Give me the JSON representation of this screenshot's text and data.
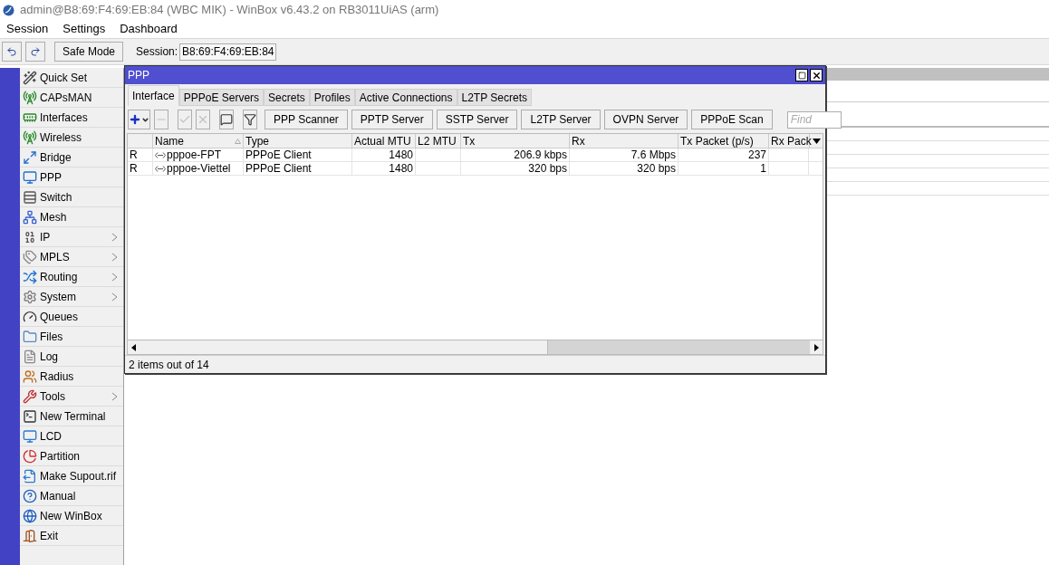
{
  "window": {
    "title": "admin@B8:69:F4:69:EB:84 (WBC MIK) - WinBox v6.43.2 on RB3011UiAS (arm)"
  },
  "menu": [
    "Session",
    "Settings",
    "Dashboard"
  ],
  "toolbar": {
    "safe_mode": {
      "label": "Safe Mode",
      "on": false
    },
    "session_label": "Session:",
    "session_value": "B8:69:F4:69:EB:84"
  },
  "sidebar": {
    "items": [
      {
        "label": "Quick Set",
        "has_submenu": false
      },
      {
        "label": "CAPsMAN",
        "has_submenu": false
      },
      {
        "label": "Interfaces",
        "has_submenu": false
      },
      {
        "label": "Wireless",
        "has_submenu": false
      },
      {
        "label": "Bridge",
        "has_submenu": false
      },
      {
        "label": "PPP",
        "has_submenu": false
      },
      {
        "label": "Switch",
        "has_submenu": false
      },
      {
        "label": "Mesh",
        "has_submenu": false
      },
      {
        "label": "IP",
        "has_submenu": true
      },
      {
        "label": "MPLS",
        "has_submenu": true
      },
      {
        "label": "Routing",
        "has_submenu": true
      },
      {
        "label": "System",
        "has_submenu": true
      },
      {
        "label": "Queues",
        "has_submenu": false
      },
      {
        "label": "Files",
        "has_submenu": false
      },
      {
        "label": "Log",
        "has_submenu": false
      },
      {
        "label": "Radius",
        "has_submenu": false
      },
      {
        "label": "Tools",
        "has_submenu": true
      },
      {
        "label": "New Terminal",
        "has_submenu": false
      },
      {
        "label": "LCD",
        "has_submenu": false
      },
      {
        "label": "Partition",
        "has_submenu": false
      },
      {
        "label": "Make Supout.rif",
        "has_submenu": false
      },
      {
        "label": "Manual",
        "has_submenu": false
      },
      {
        "label": "New WinBox",
        "has_submenu": false
      },
      {
        "label": "Exit",
        "has_submenu": false
      }
    ]
  },
  "ppp_window": {
    "title": "PPP",
    "tabs": [
      {
        "label": "Interface",
        "selected": true
      },
      {
        "label": "PPPoE Servers",
        "selected": false
      },
      {
        "label": "Secrets",
        "selected": false
      },
      {
        "label": "Profiles",
        "selected": false
      },
      {
        "label": "Active Connections",
        "selected": false
      },
      {
        "label": "L2TP Secrets",
        "selected": false
      }
    ],
    "icon_buttons": [
      {
        "kind": "add",
        "disabled": false
      },
      {
        "kind": "remove",
        "disabled": true
      },
      {
        "kind": "enable",
        "disabled": true
      },
      {
        "kind": "disable",
        "disabled": true
      },
      {
        "kind": "comment",
        "disabled": false
      },
      {
        "kind": "filter",
        "disabled": false
      }
    ],
    "buttons": [
      "PPP Scanner",
      "PPTP Server",
      "SSTP Server",
      "L2TP Server",
      "OVPN Server",
      "PPPoE Scan"
    ],
    "find": {
      "placeholder": "Find"
    },
    "table": {
      "columns": [
        "",
        "Name",
        "Type",
        "Actual MTU",
        "L2 MTU",
        "Tx",
        "Rx",
        "Tx Packet (p/s)",
        "Rx Pack"
      ],
      "rows": [
        [
          "R",
          "pppoe-FPT",
          "PPPoE Client",
          "1480",
          "",
          "206.9 kbps",
          "7.6 Mbps",
          "237",
          ""
        ],
        [
          "R",
          "pppoe-Viettel",
          "PPPoE Client",
          "1480",
          "",
          "320 bps",
          "320 bps",
          "1",
          ""
        ]
      ]
    },
    "status": "2 items out of 14"
  }
}
